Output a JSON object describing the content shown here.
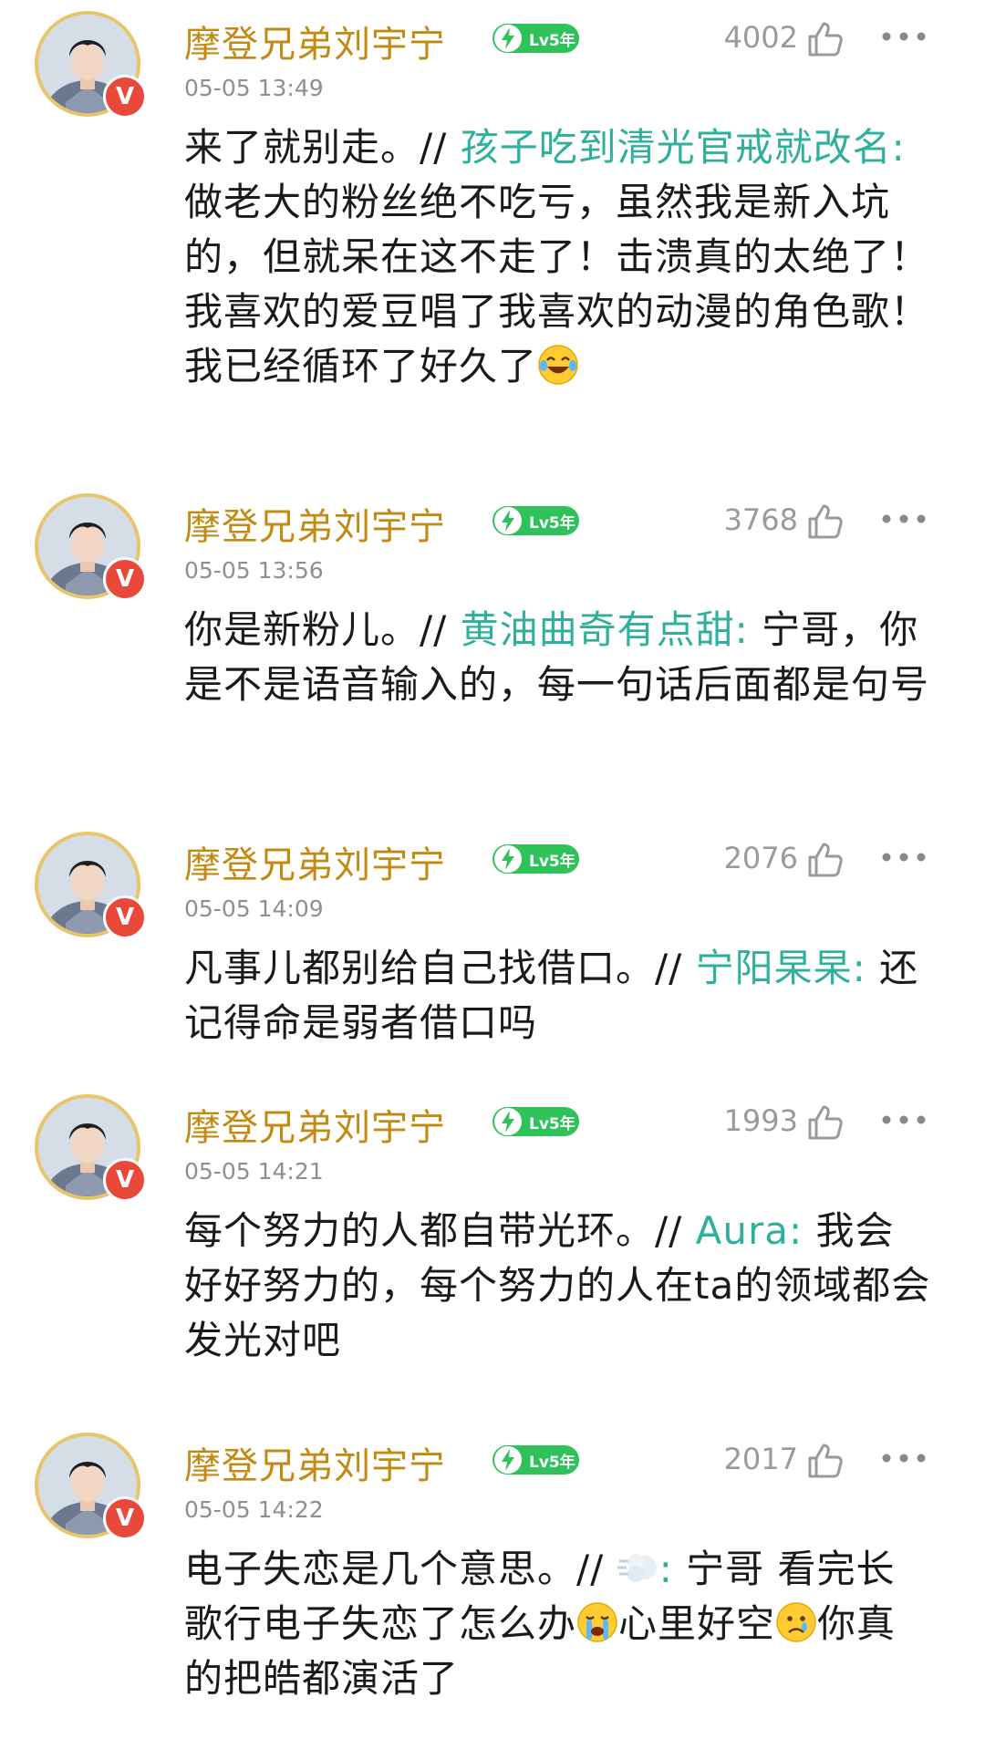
{
  "comments": [
    {
      "username": "摩登兄弟刘宇宁",
      "level": "Lv5年",
      "time": "05-05 13:49",
      "likes": "4002",
      "text_before": "来了就别走。// ",
      "reply_user": "孩子吃到清光官戒就改名:",
      "text_after": " 做老大的粉丝绝不吃亏，虽然我是新入坑的，但就呆在这不走了！击溃真的太绝了！我喜欢的爱豆唱了我喜欢的动漫的角色歌！我已经循环了好久了",
      "emoji": "laughing-tears"
    },
    {
      "username": "摩登兄弟刘宇宁",
      "level": "Lv5年",
      "time": "05-05 13:56",
      "likes": "3768",
      "text_before": "你是新粉儿。// ",
      "reply_user": "黄油曲奇有点甜:",
      "text_after": " 宁哥，你是不是语音输入的，每一句话后面都是句号"
    },
    {
      "username": "摩登兄弟刘宇宁",
      "level": "Lv5年",
      "time": "05-05 14:09",
      "likes": "2076",
      "text_before": "凡事儿都别给自己找借口。// ",
      "reply_user": "宁阳杲杲:",
      "text_after": " 还记得命是弱者借口吗"
    },
    {
      "username": "摩登兄弟刘宇宁",
      "level": "Lv5年",
      "time": "05-05 14:21",
      "likes": "1993",
      "text_before": "每个努力的人都自带光环。// ",
      "reply_user": "Aura:",
      "text_after": " 我会好好努力的，每个努力的人在ta的领域都会发光对吧"
    },
    {
      "username": "摩登兄弟刘宇宁",
      "level": "Lv5年",
      "time": "05-05 14:22",
      "likes": "2017",
      "text_before": "电子失恋是几个意思。// ",
      "reply_user": ":",
      "text_mid1": " 宁哥 看完长歌行电子失恋了怎么办",
      "text_mid2": "心里好空",
      "text_after": "你真的把皓都演活了"
    }
  ],
  "colors": {
    "username": "#c28a12",
    "reply": "#2fb09d",
    "badge": "#2fc25b",
    "verified": "#e8493b"
  },
  "icons": [
    "avatar",
    "verified-badge-icon",
    "lightning-icon",
    "thumb-up-icon",
    "more-dots-icon",
    "laughing-tears-emoji",
    "dash-emoji",
    "crying-emoji",
    "sad-emoji"
  ]
}
